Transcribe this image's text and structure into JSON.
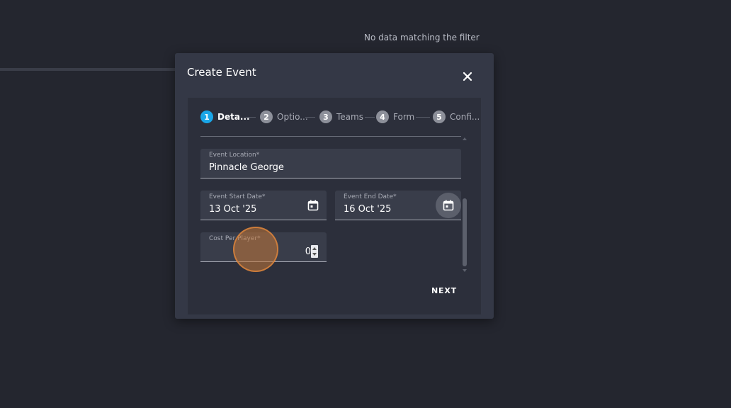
{
  "background": {
    "empty_message": "No data matching the filter"
  },
  "dialog": {
    "title": "Create Event",
    "close_icon": "close-icon",
    "steps": [
      {
        "number": "1",
        "label": "Deta...",
        "active": true
      },
      {
        "number": "2",
        "label": "Optio...",
        "active": false
      },
      {
        "number": "3",
        "label": "Teams",
        "active": false
      },
      {
        "number": "4",
        "label": "Form",
        "active": false
      },
      {
        "number": "5",
        "label": "Confi...",
        "active": false
      }
    ],
    "fields": {
      "location": {
        "label": "Event Location*",
        "value": "Pinnacle George"
      },
      "start_date": {
        "label": "Event Start Date*",
        "value": "13 Oct '25",
        "icon": "calendar-icon"
      },
      "end_date": {
        "label": "Event End Date*",
        "value": "16 Oct '25",
        "icon": "calendar-icon"
      },
      "cost": {
        "label": "Cost Per Player*",
        "value": "0"
      }
    },
    "next_label": "NEXT"
  },
  "colors": {
    "background": "#24262f",
    "dialog": "#343846",
    "content": "#2c2f3b",
    "field": "#393d4a",
    "active_step": "#1aa6e8",
    "inactive_step": "#8d909a",
    "click_indicator": "#c4783a"
  }
}
